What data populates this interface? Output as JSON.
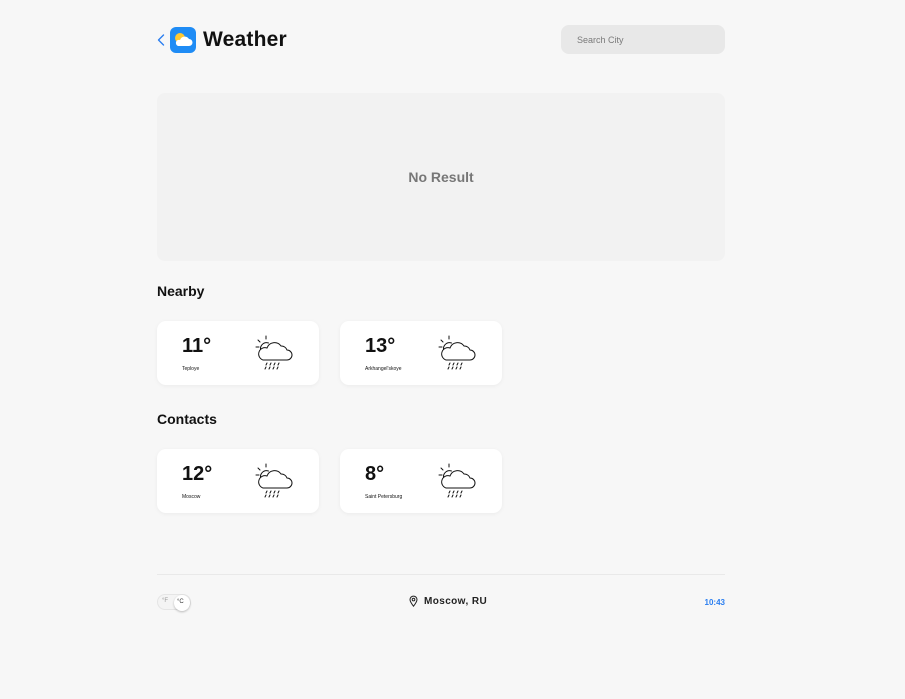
{
  "header": {
    "back_icon": "chevron-left-icon",
    "app_icon": "weather-app-icon",
    "title": "Weather",
    "search_placeholder": "Search City"
  },
  "results": {
    "empty_text": "No Result"
  },
  "nearby": {
    "title": "Nearby",
    "cards": [
      {
        "temp": "11°",
        "city": "Teploye",
        "icon": "sun-cloud-rain-icon"
      },
      {
        "temp": "13°",
        "city": "Arkhangel'skoye",
        "icon": "sun-cloud-rain-icon"
      }
    ]
  },
  "contacts": {
    "title": "Contacts",
    "cards": [
      {
        "temp": "12°",
        "city": "Moscow",
        "icon": "sun-cloud-rain-icon"
      },
      {
        "temp": "8°",
        "city": "Saint Petersburg",
        "icon": "sun-cloud-rain-icon"
      }
    ]
  },
  "footer": {
    "unit_f": "°F",
    "unit_c": "°C",
    "unit_selected": "C",
    "location_icon": "map-pin-icon",
    "location": "Moscow, RU",
    "time": "10:43"
  },
  "colors": {
    "accent": "#2a7ef0",
    "app_icon_bg": "#1f8cf5",
    "background": "#f7f7f7",
    "card": "#ffffff"
  }
}
